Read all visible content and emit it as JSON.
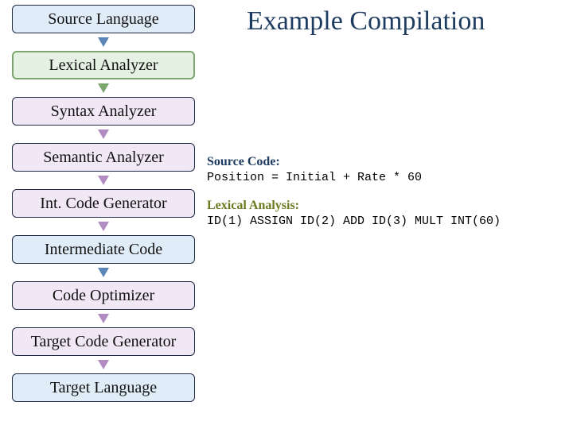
{
  "title": "Example Compilation",
  "stages": {
    "s0": "Source Language",
    "s1": "Lexical Analyzer",
    "s2": "Syntax Analyzer",
    "s3": "Semantic Analyzer",
    "s4": "Int. Code Generator",
    "s5": "Intermediate Code",
    "s6": "Code Optimizer",
    "s7": "Target Code Generator",
    "s8": "Target Language"
  },
  "sections": {
    "source_label": "Source Code:",
    "source_code": "Position = Initial + Rate * 60",
    "lexical_label": "Lexical Analysis:",
    "lexical_code": "ID(1) ASSIGN ID(2) ADD ID(3) MULT INT(60)"
  }
}
